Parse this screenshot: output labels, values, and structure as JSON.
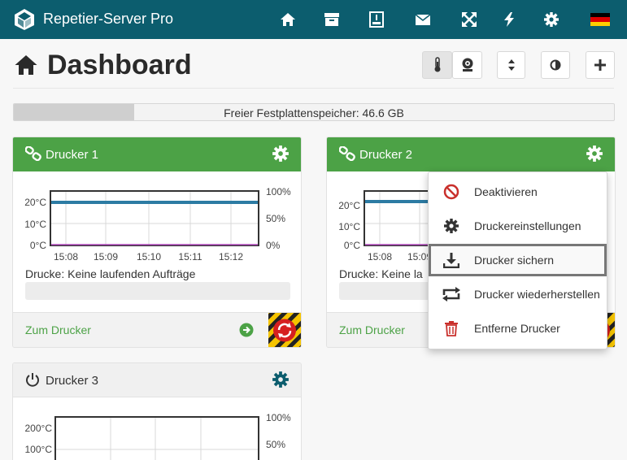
{
  "app": {
    "title": "Repetier-Server Pro"
  },
  "nav": {
    "icons": [
      "home-icon",
      "archive-icon",
      "printer-icon",
      "mail-icon",
      "fullscreen-icon",
      "bolt-icon",
      "settings-icon",
      "german-flag"
    ]
  },
  "page": {
    "title": "Dashboard"
  },
  "disk": {
    "label": "Freier Festplattenspeicher: 46.6 GB",
    "used_fraction": 0.2
  },
  "colors": {
    "topbar": "#0c5d6e",
    "online": "#4ca246",
    "temp_line": "#2c7ba3",
    "danger": "#c9302c"
  },
  "printers": [
    {
      "name": "Drucker 1",
      "status": "online",
      "chart": {
        "y_left_ticks": [
          "20°C",
          "10°C",
          "0°C"
        ],
        "y_right_ticks": [
          "100%",
          "50%",
          "0%"
        ],
        "x_ticks": [
          "15:08",
          "15:09",
          "15:10",
          "15:11",
          "15:12"
        ]
      },
      "prints_label": "Drucke: Keine laufenden Aufträge",
      "link": "Zum Drucker"
    },
    {
      "name": "Drucker 2",
      "status": "online",
      "chart": {
        "y_left_ticks": [
          "20°C",
          "10°C",
          "0°C"
        ],
        "x_ticks": [
          "15:08",
          "15:09"
        ]
      },
      "prints_label": "Drucke: Keine la",
      "link": "Zum Drucker"
    },
    {
      "name": "Drucker 3",
      "status": "offline",
      "chart": {
        "y_left_ticks": [
          "200°C",
          "100°C"
        ],
        "y_right_ticks": [
          "100%",
          "50%"
        ]
      }
    }
  ],
  "menu": {
    "items": [
      {
        "label": "Deaktivieren",
        "icon": "ban-icon"
      },
      {
        "label": "Druckereinstellungen",
        "icon": "gear-icon"
      },
      {
        "label": "Drucker sichern",
        "icon": "download-icon"
      },
      {
        "label": "Drucker wiederherstellen",
        "icon": "restore-icon"
      },
      {
        "label": "Entferne Drucker",
        "icon": "trash-icon"
      }
    ]
  }
}
